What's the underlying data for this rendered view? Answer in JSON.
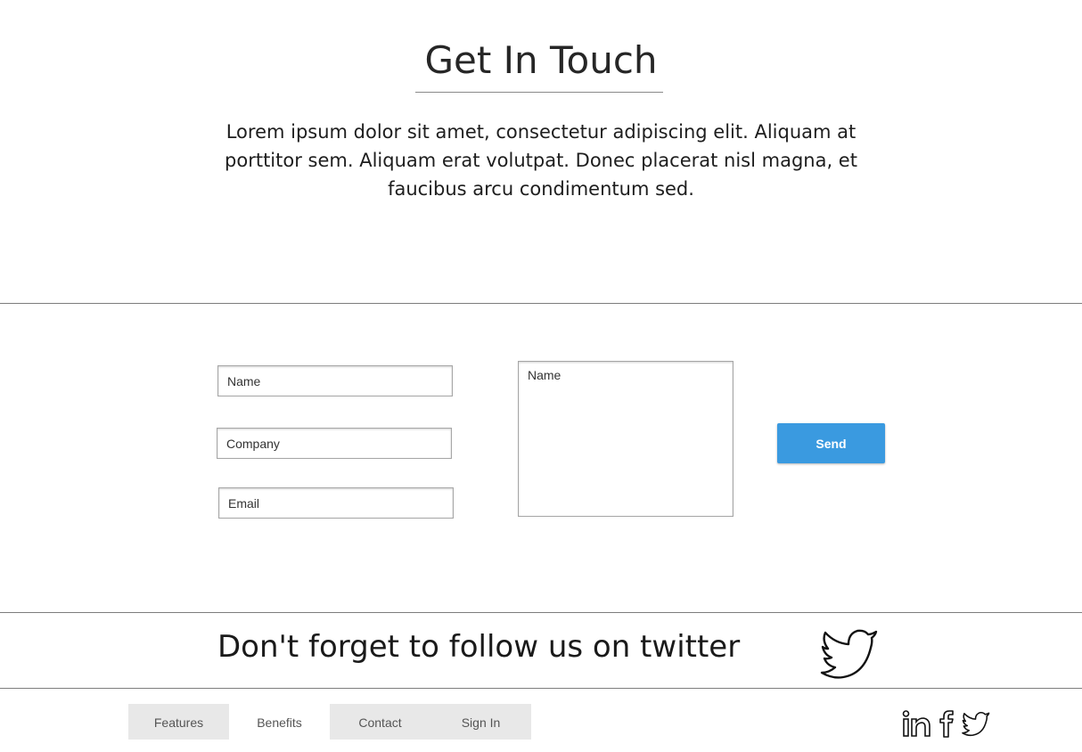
{
  "header": {
    "title": "Get In Touch",
    "intro": "Lorem ipsum dolor sit amet, consectetur adipiscing elit. Aliquam at porttitor sem. Aliquam erat volutpat. Donec placerat nisl magna, et faucibus arcu condimentum sed."
  },
  "form": {
    "name_placeholder": "Name",
    "company_placeholder": "Company",
    "email_placeholder": "Email",
    "message_placeholder": "Name",
    "send_label": "Send"
  },
  "follow": {
    "text": "Don't forget to follow us on twitter",
    "icon": "twitter-icon"
  },
  "footer": {
    "nav": [
      {
        "label": "Features"
      },
      {
        "label": "Benefits"
      },
      {
        "label": "Contact"
      },
      {
        "label": "Sign In"
      }
    ],
    "social_icons": [
      "linkedin-icon",
      "facebook-icon",
      "twitter-icon"
    ]
  },
  "colors": {
    "accent": "#3a9ae0",
    "nav_shade": "#e8e8e8",
    "rule": "#7d7d7d"
  }
}
